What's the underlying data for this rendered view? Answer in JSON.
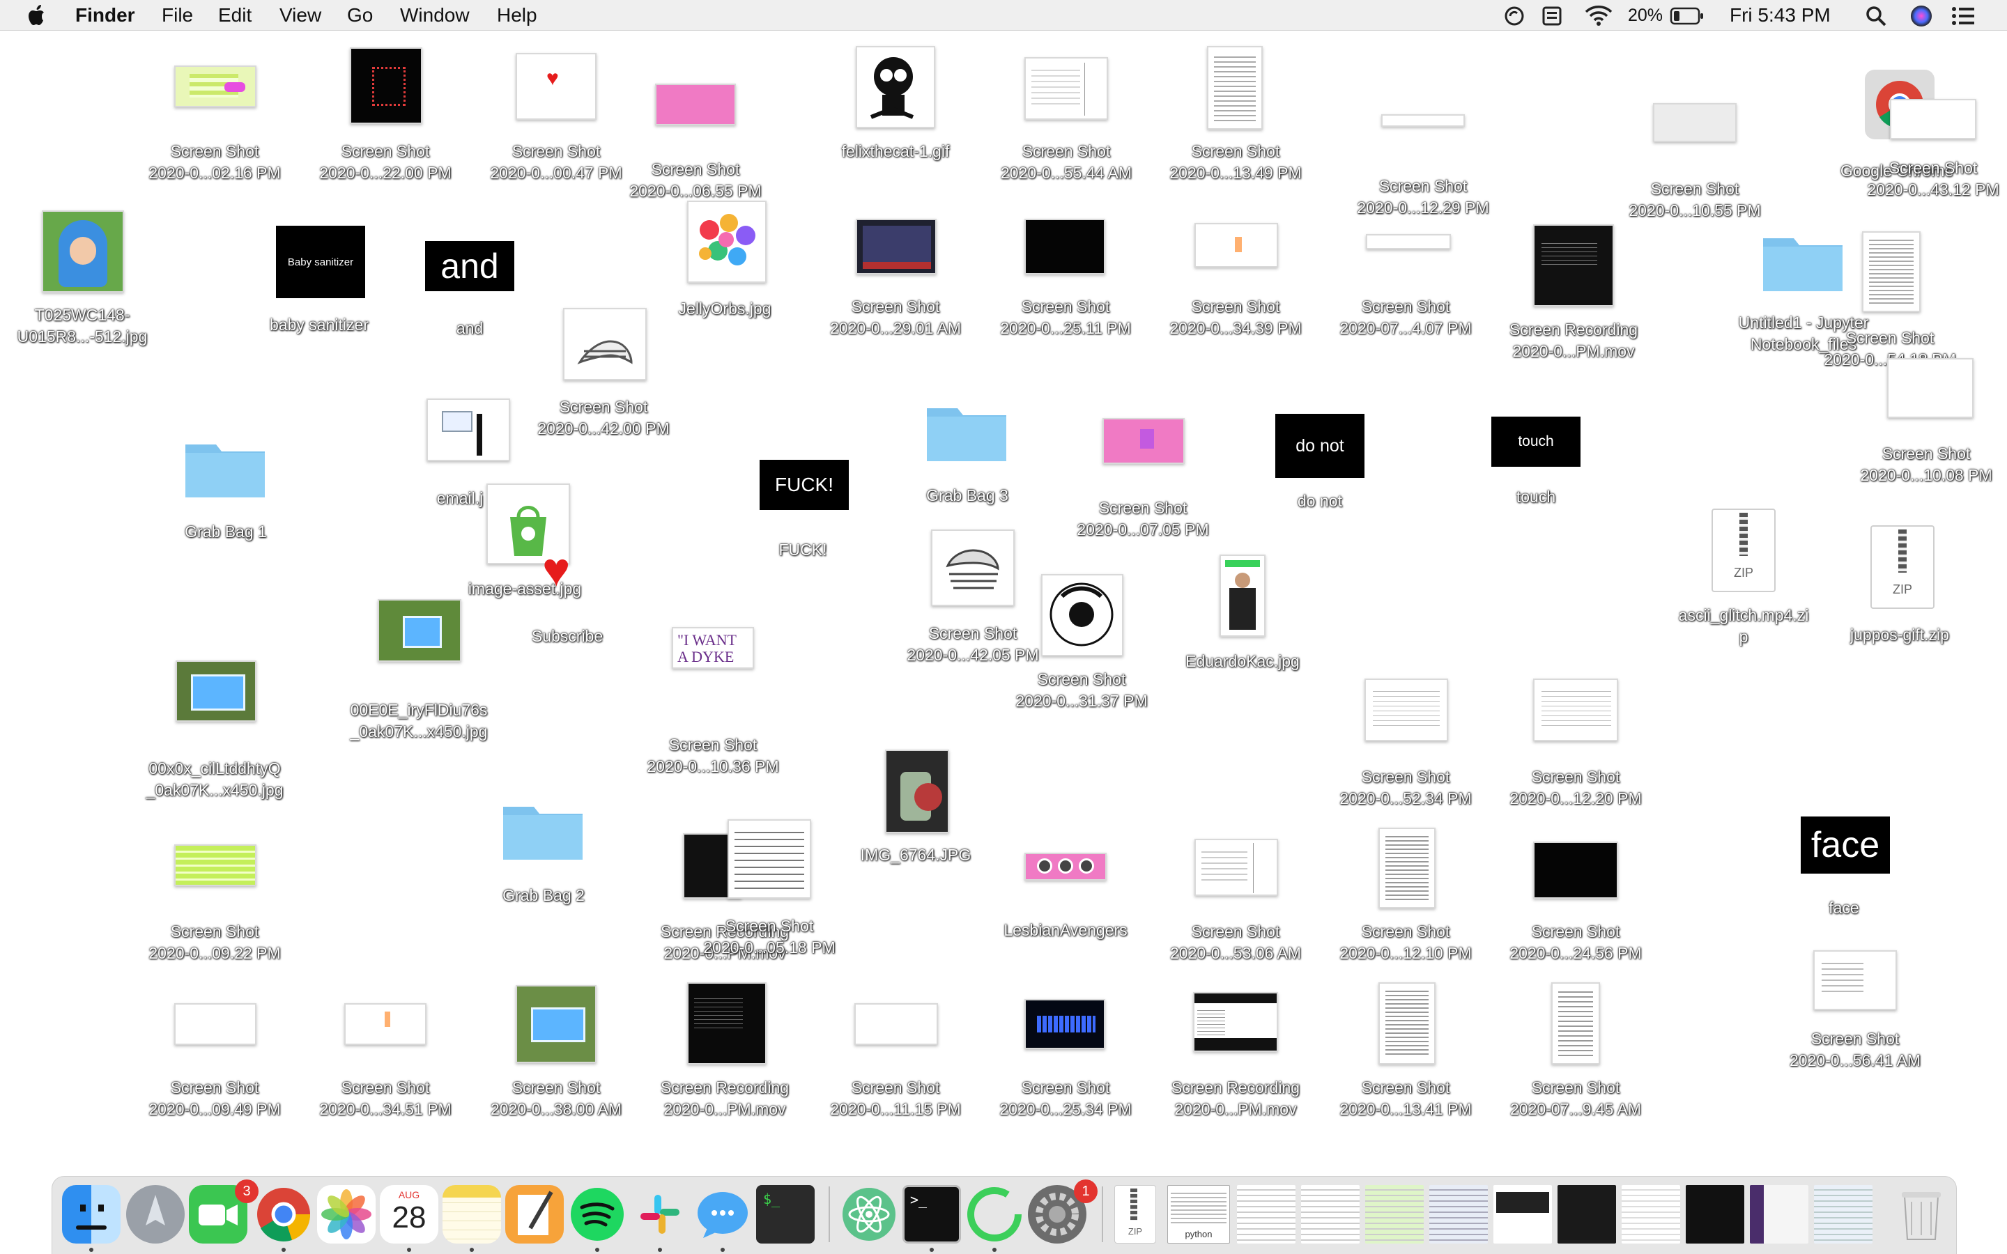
{
  "menubar": {
    "apple": "",
    "app": "Finder",
    "items": [
      "File",
      "Edit",
      "View",
      "Go",
      "Window",
      "Help"
    ],
    "battery_percent": "20%",
    "clock": "Fri 5:43 PM"
  },
  "desktop_items": [
    {
      "name": "Screen Shot",
      "sub": "2020-0...02.16 PM"
    },
    {
      "name": "Screen Shot",
      "sub": "2020-0...22.00 PM"
    },
    {
      "name": "Screen Shot",
      "sub": "2020-0...00.47 PM"
    },
    {
      "name": "Screen Shot",
      "sub": "2020-0...06.55 PM"
    },
    {
      "name": "felixthecat-1.gif",
      "sub": ""
    },
    {
      "name": "Screen Shot",
      "sub": "2020-0...55.44 AM"
    },
    {
      "name": "Screen Shot",
      "sub": "2020-0...13.49 PM"
    },
    {
      "name": "Screen Shot",
      "sub": "2020-0...12.29 PM"
    },
    {
      "name": "Screen Shot",
      "sub": "2020-0...10.55 PM"
    },
    {
      "name": "Google Chrome",
      "sub": ""
    },
    {
      "name": "Screen Shot",
      "sub": "2020-0...43.12 PM"
    },
    {
      "name": "T025WC148-",
      "sub": "U015R8...-512.jpg"
    },
    {
      "name": "baby sanitizer",
      "sub": ""
    },
    {
      "name": "and",
      "sub": ""
    },
    {
      "name": "JellyOrbs.jpg",
      "sub": ""
    },
    {
      "name": "Screen Shot",
      "sub": "2020-0...29.01 AM"
    },
    {
      "name": "Screen Shot",
      "sub": "2020-0...25.11 PM"
    },
    {
      "name": "Screen Shot",
      "sub": "2020-0...34.39 PM"
    },
    {
      "name": "Screen Shot",
      "sub": "2020-07...4.07 PM"
    },
    {
      "name": "Screen Recording",
      "sub": "2020-0...PM.mov"
    },
    {
      "name": "Untitled1 - Jupyter",
      "sub": "Notebook_files"
    },
    {
      "name": "Screen Shot",
      "sub": "2020-0...54.18 PM"
    },
    {
      "name": "Screen Shot",
      "sub": "2020-0...42.00 PM"
    },
    {
      "name": "email.j",
      "sub": ""
    },
    {
      "name": "Grab Bag 1",
      "sub": ""
    },
    {
      "name": "FUCK!",
      "sub": ""
    },
    {
      "name": "Grab Bag 3",
      "sub": ""
    },
    {
      "name": "Screen Shot",
      "sub": "2020-0...07.05 PM"
    },
    {
      "name": "do not",
      "sub": ""
    },
    {
      "name": "touch",
      "sub": ""
    },
    {
      "name": "Screen Shot",
      "sub": "2020-0...10.08 PM"
    },
    {
      "name": "image-asset.jpg",
      "sub": ""
    },
    {
      "name": "Subscribe",
      "sub": ""
    },
    {
      "name": "Screen Shot",
      "sub": "2020-0...42.05 PM"
    },
    {
      "name": "Screen Shot",
      "sub": "2020-0...31.37 PM"
    },
    {
      "name": "EduardoKac.jpg",
      "sub": ""
    },
    {
      "name": "ascii_glitch.mp4.zi",
      "sub": "p"
    },
    {
      "name": "juppos-gift.zip",
      "sub": ""
    },
    {
      "name": "00E0E_iryFlDiu76s",
      "sub": "_0ak07K...x450.jpg"
    },
    {
      "name": "Screen Shot",
      "sub": "2020-0...10.36 PM"
    },
    {
      "name": "00x0x_cilLtddhtyQ",
      "sub": "_0ak07K...x450.jpg"
    },
    {
      "name": "Screen Shot",
      "sub": "2020-0...52.34 PM"
    },
    {
      "name": "Screen Shot",
      "sub": "2020-0...12.20 PM"
    },
    {
      "name": "IMG_6764.JPG",
      "sub": ""
    },
    {
      "name": "Grab Bag 2",
      "sub": ""
    },
    {
      "name": "Screen Recording",
      "sub": "2020-0...PM.mov"
    },
    {
      "name": "Screen Shot",
      "sub": "2020-0...05.18 PM"
    },
    {
      "name": "face",
      "sub": ""
    },
    {
      "name": "Screen Shot",
      "sub": "2020-0...09.22 PM"
    },
    {
      "name": "LesbianAvengers",
      "sub": ""
    },
    {
      "name": "Screen Shot",
      "sub": "2020-0...53.06 AM"
    },
    {
      "name": "Screen Shot",
      "sub": "2020-0...12.10 PM"
    },
    {
      "name": "Screen Shot",
      "sub": "2020-0...24.56 PM"
    },
    {
      "name": "Screen Shot",
      "sub": "2020-0...56.41 AM"
    },
    {
      "name": "Screen Shot",
      "sub": "2020-0...09.49 PM"
    },
    {
      "name": "Screen Shot",
      "sub": "2020-0...34.51 PM"
    },
    {
      "name": "Screen Shot",
      "sub": "2020-0...38.00 AM"
    },
    {
      "name": "Screen Recording",
      "sub": "2020-0...PM.mov"
    },
    {
      "name": "Screen Shot",
      "sub": "2020-0...11.15 PM"
    },
    {
      "name": "Screen Shot",
      "sub": "2020-0...25.34 PM"
    },
    {
      "name": "Screen Recording",
      "sub": "2020-0...PM.mov"
    },
    {
      "name": "Screen Shot",
      "sub": "2020-0...13.41 PM"
    },
    {
      "name": "Screen Shot",
      "sub": "2020-07...9.45 AM"
    }
  ],
  "thumb_text": {
    "baby": "Baby sanitizer",
    "and": "and",
    "fuck": "FUCK!",
    "donot": "do not",
    "touch": "touch",
    "face": "face",
    "dyke1": "\"I WANT",
    "dyke2": "A DYKE",
    "zip": "ZIP",
    "python": "python"
  },
  "dock": {
    "apps": [
      "Finder",
      "Launchpad",
      "FaceTime",
      "Google Chrome",
      "Photos",
      "Calendar",
      "Notes",
      "Pages",
      "Spotify",
      "Slack",
      "Messages",
      "Terminal-green",
      "Atom",
      "Terminal",
      "Recorder",
      "System Preferences"
    ],
    "calendar_month": "AUG",
    "calendar_day": "28",
    "facetime_badge": "3",
    "prefs_badge": "1"
  },
  "colors": {
    "folder": "#7ec3ee",
    "accent": "#e3342f"
  }
}
